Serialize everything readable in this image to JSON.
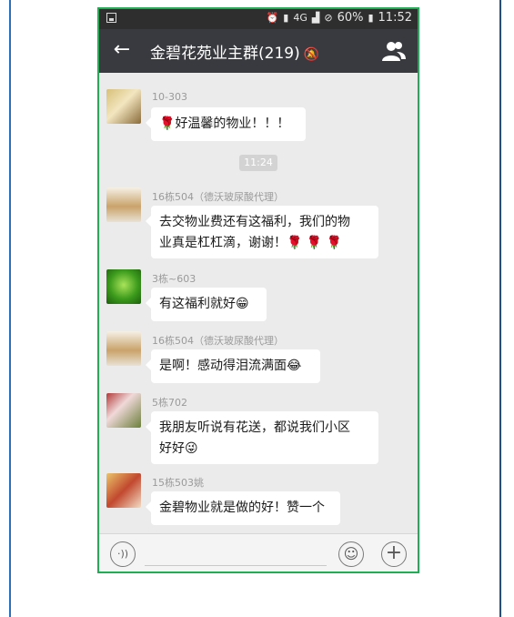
{
  "statusbar": {
    "network": "4G",
    "battery": "60%",
    "time": "11:52"
  },
  "titlebar": {
    "title": "金碧花苑业主群(219)",
    "back_icon": "back-arrow-icon",
    "group_icon": "group-members-icon"
  },
  "timestamp": "11:24",
  "messages": [
    {
      "sender": "10-303",
      "text": "好温馨的物业！！！",
      "prefix": "🌹"
    },
    {
      "sender": "16栋504（德沃玻尿酸代理）",
      "line1": "去交物业费还有这福利，我们的物",
      "line2": "业真是杠杠滴，谢谢！",
      "roses": "🌹 🌹 🌹"
    },
    {
      "sender": "3栋~603",
      "text": "有这福利就好",
      "emoji": "😁"
    },
    {
      "sender": "16栋504（德沃玻尿酸代理）",
      "text": "是啊！感动得泪流满面",
      "emoji": "😂"
    },
    {
      "sender": "5栋702",
      "line1": "我朋友听说有花送，都说我们小区",
      "line2": "好好",
      "emoji": "😜"
    },
    {
      "sender": "15栋503姚",
      "text": "金碧物业就是做的好！赞一个"
    }
  ],
  "inputbar": {
    "voice_icon": "voice-icon",
    "emoji_icon": "emoji-icon",
    "plus_icon": "plus-icon"
  }
}
